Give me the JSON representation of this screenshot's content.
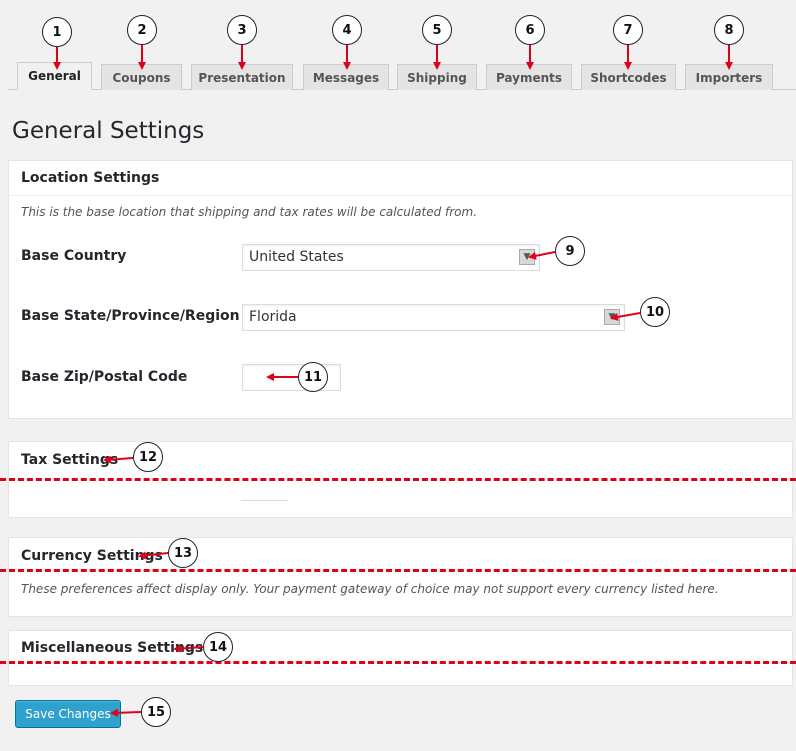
{
  "tabs": [
    {
      "label": "General",
      "active": true
    },
    {
      "label": "Coupons"
    },
    {
      "label": "Presentation"
    },
    {
      "label": "Messages"
    },
    {
      "label": "Shipping"
    },
    {
      "label": "Payments"
    },
    {
      "label": "Shortcodes"
    },
    {
      "label": "Importers"
    }
  ],
  "page_title": "General Settings",
  "location": {
    "title": "Location Settings",
    "description": "This is the base location that shipping and tax rates will be calculated from.",
    "base_country_label": "Base Country",
    "base_country_value": "United States",
    "base_state_label": "Base State/Province/Region",
    "base_state_value": "Florida",
    "zip_label": "Base Zip/Postal Code",
    "zip_value": ""
  },
  "tax": {
    "title": "Tax Settings"
  },
  "currency": {
    "title": "Currency Settings",
    "description": "These preferences affect display only. Your payment gateway of choice may not support every currency listed here."
  },
  "misc": {
    "title": "Miscellaneous Settings"
  },
  "save_label": "Save Changes",
  "callouts": [
    "1",
    "2",
    "3",
    "4",
    "5",
    "6",
    "7",
    "8",
    "9",
    "10",
    "11",
    "12",
    "13",
    "14",
    "15"
  ],
  "colors": {
    "accent": "#2ea2cc",
    "annotation": "#e0001a"
  },
  "icons": {
    "select_arrow": "chevron-down-icon"
  }
}
